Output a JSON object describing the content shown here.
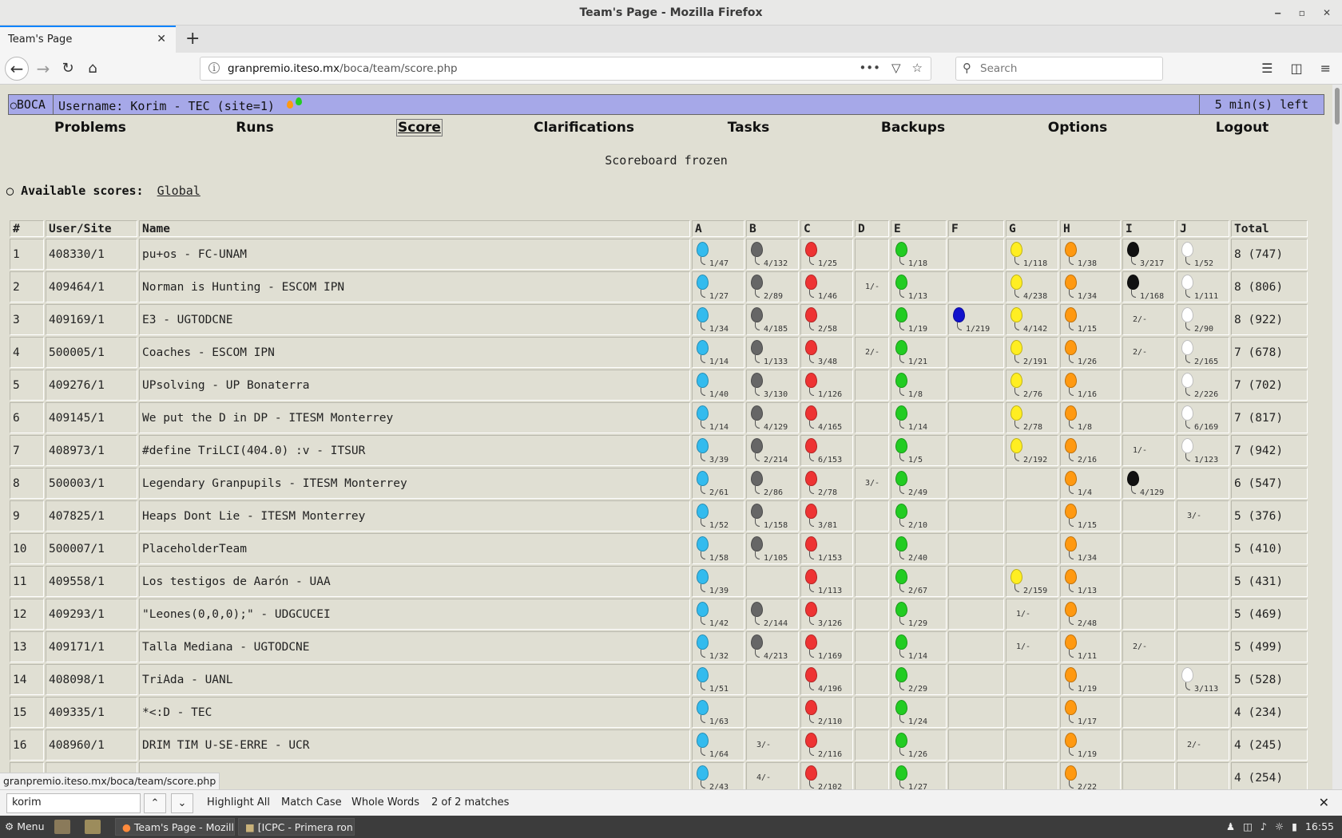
{
  "window": {
    "title": "Team's Page - Mozilla Firefox",
    "ctrl_min": "‒",
    "ctrl_max": "▫",
    "ctrl_close": "✕"
  },
  "tab": {
    "label": "Team's Page",
    "close": "✕",
    "new": "+"
  },
  "nav": {
    "url_host": "granpremio.iteso.mx",
    "url_path": "/boca/team/score.php",
    "search_placeholder": "Search"
  },
  "boca": {
    "logo": "BOCA",
    "username": "Username: Korim - TEC (site=1)",
    "time_left": "5 min(s) left",
    "menu": [
      "Problems",
      "Runs",
      "Score",
      "Clarifications",
      "Tasks",
      "Backups",
      "Options",
      "Logout"
    ],
    "frozen": "Scoreboard frozen",
    "available_label": "Available scores:",
    "available_link": "Global"
  },
  "table": {
    "headers": [
      "#",
      "User/Site",
      "Name",
      "A",
      "B",
      "C",
      "D",
      "E",
      "F",
      "G",
      "H",
      "I",
      "J",
      "Total"
    ],
    "problem_colors": {
      "A": "#33bbee",
      "B": "#666666",
      "C": "#ee3333",
      "D": "#aaaaaa",
      "E": "#22cc22",
      "F": "#1111cc",
      "G": "#ffee22",
      "H": "#ff9911",
      "I": "#111111",
      "J": "#ffffff"
    },
    "rows": [
      {
        "rank": "1",
        "user": "408330/1",
        "name": "pu+os - FC-UNAM",
        "cells": [
          [
            "s",
            "1/47"
          ],
          [
            "s",
            "4/132"
          ],
          [
            "s",
            "1/25"
          ],
          [
            "",
            ""
          ],
          [
            "s",
            "1/18"
          ],
          [
            "",
            ""
          ],
          [
            "s",
            "1/118"
          ],
          [
            "s",
            "1/38"
          ],
          [
            "s",
            "3/217"
          ],
          [
            "s",
            "1/52"
          ]
        ],
        "total": "8 (747)"
      },
      {
        "rank": "2",
        "user": "409464/1",
        "name": "Norman is Hunting - ESCOM IPN",
        "cells": [
          [
            "s",
            "1/27"
          ],
          [
            "s",
            "2/89"
          ],
          [
            "s",
            "1/46"
          ],
          [
            "t",
            "1/-"
          ],
          [
            "s",
            "1/13"
          ],
          [
            "",
            ""
          ],
          [
            "s",
            "4/238"
          ],
          [
            "s",
            "1/34"
          ],
          [
            "s",
            "1/168"
          ],
          [
            "s",
            "1/111"
          ]
        ],
        "total": "8 (806)"
      },
      {
        "rank": "3",
        "user": "409169/1",
        "name": "E3 - UGTODCNE",
        "cells": [
          [
            "s",
            "1/34"
          ],
          [
            "s",
            "4/185"
          ],
          [
            "s",
            "2/58"
          ],
          [
            "",
            ""
          ],
          [
            "s",
            "1/19"
          ],
          [
            "s",
            "1/219"
          ],
          [
            "s",
            "4/142"
          ],
          [
            "s",
            "1/15"
          ],
          [
            "t",
            "2/-"
          ],
          [
            "s",
            "2/90"
          ]
        ],
        "total": "8 (922)"
      },
      {
        "rank": "4",
        "user": "500005/1",
        "name": "Coaches - ESCOM IPN",
        "cells": [
          [
            "s",
            "1/14"
          ],
          [
            "s",
            "1/133"
          ],
          [
            "s",
            "3/48"
          ],
          [
            "t",
            "2/-"
          ],
          [
            "s",
            "1/21"
          ],
          [
            "",
            ""
          ],
          [
            "s",
            "2/191"
          ],
          [
            "s",
            "1/26"
          ],
          [
            "t",
            "2/-"
          ],
          [
            "s",
            "2/165"
          ]
        ],
        "total": "7 (678)"
      },
      {
        "rank": "5",
        "user": "409276/1",
        "name": "UPsolving - UP Bonaterra",
        "cells": [
          [
            "s",
            "1/40"
          ],
          [
            "s",
            "3/130"
          ],
          [
            "s",
            "1/126"
          ],
          [
            "",
            ""
          ],
          [
            "s",
            "1/8"
          ],
          [
            "",
            ""
          ],
          [
            "s",
            "2/76"
          ],
          [
            "s",
            "1/16"
          ],
          [
            "",
            ""
          ],
          [
            "s",
            "2/226"
          ]
        ],
        "total": "7 (702)"
      },
      {
        "rank": "6",
        "user": "409145/1",
        "name": "We put the D in DP - ITESM Monterrey",
        "cells": [
          [
            "s",
            "1/14"
          ],
          [
            "s",
            "4/129"
          ],
          [
            "s",
            "4/165"
          ],
          [
            "",
            ""
          ],
          [
            "s",
            "1/14"
          ],
          [
            "",
            ""
          ],
          [
            "s",
            "2/78"
          ],
          [
            "s",
            "1/8"
          ],
          [
            "",
            ""
          ],
          [
            "s",
            "6/169"
          ]
        ],
        "total": "7 (817)"
      },
      {
        "rank": "7",
        "user": "408973/1",
        "name": "#define TriLCI(404.0) :v - ITSUR",
        "cells": [
          [
            "s",
            "3/39"
          ],
          [
            "s",
            "2/214"
          ],
          [
            "s",
            "6/153"
          ],
          [
            "",
            ""
          ],
          [
            "s",
            "1/5"
          ],
          [
            "",
            ""
          ],
          [
            "s",
            "2/192"
          ],
          [
            "s",
            "2/16"
          ],
          [
            "t",
            "1/-"
          ],
          [
            "s",
            "1/123"
          ]
        ],
        "total": "7 (942)"
      },
      {
        "rank": "8",
        "user": "500003/1",
        "name": "Legendary Granpupils - ITESM Monterrey",
        "cells": [
          [
            "s",
            "2/61"
          ],
          [
            "s",
            "2/86"
          ],
          [
            "s",
            "2/78"
          ],
          [
            "t",
            "3/-"
          ],
          [
            "s",
            "2/49"
          ],
          [
            "",
            ""
          ],
          [
            "",
            ""
          ],
          [
            "s",
            "1/4"
          ],
          [
            "s",
            "4/129"
          ],
          [
            "",
            ""
          ]
        ],
        "total": "6 (547)"
      },
      {
        "rank": "9",
        "user": "407825/1",
        "name": "Heaps Dont Lie - ITESM Monterrey",
        "cells": [
          [
            "s",
            "1/52"
          ],
          [
            "s",
            "1/158"
          ],
          [
            "s",
            "3/81"
          ],
          [
            "",
            ""
          ],
          [
            "s",
            "2/10"
          ],
          [
            "",
            ""
          ],
          [
            "",
            ""
          ],
          [
            "s",
            "1/15"
          ],
          [
            "",
            ""
          ],
          [
            "t",
            "3/-"
          ]
        ],
        "total": "5 (376)"
      },
      {
        "rank": "10",
        "user": "500007/1",
        "name": "PlaceholderTeam",
        "cells": [
          [
            "s",
            "1/58"
          ],
          [
            "s",
            "1/105"
          ],
          [
            "s",
            "1/153"
          ],
          [
            "",
            ""
          ],
          [
            "s",
            "2/40"
          ],
          [
            "",
            ""
          ],
          [
            "",
            ""
          ],
          [
            "s",
            "1/34"
          ],
          [
            "",
            ""
          ],
          [
            "",
            ""
          ]
        ],
        "total": "5 (410)"
      },
      {
        "rank": "11",
        "user": "409558/1",
        "name": "Los testigos de Aarón - UAA",
        "cells": [
          [
            "s",
            "1/39"
          ],
          [
            "",
            ""
          ],
          [
            "s",
            "1/113"
          ],
          [
            "",
            ""
          ],
          [
            "s",
            "2/67"
          ],
          [
            "",
            ""
          ],
          [
            "s",
            "2/159"
          ],
          [
            "s",
            "1/13"
          ],
          [
            "",
            ""
          ],
          [
            "",
            ""
          ]
        ],
        "total": "5 (431)"
      },
      {
        "rank": "12",
        "user": "409293/1",
        "name": "\"Leones(0,0,0);\" - UDGCUCEI",
        "cells": [
          [
            "s",
            "1/42"
          ],
          [
            "s",
            "2/144"
          ],
          [
            "s",
            "3/126"
          ],
          [
            "",
            ""
          ],
          [
            "s",
            "1/29"
          ],
          [
            "",
            ""
          ],
          [
            "t",
            "1/-"
          ],
          [
            "s",
            "2/48"
          ],
          [
            "",
            ""
          ],
          [
            "",
            ""
          ]
        ],
        "total": "5 (469)"
      },
      {
        "rank": "13",
        "user": "409171/1",
        "name": "Talla Mediana - UGTODCNE",
        "cells": [
          [
            "s",
            "1/32"
          ],
          [
            "s",
            "4/213"
          ],
          [
            "s",
            "1/169"
          ],
          [
            "",
            ""
          ],
          [
            "s",
            "1/14"
          ],
          [
            "",
            ""
          ],
          [
            "t",
            "1/-"
          ],
          [
            "s",
            "1/11"
          ],
          [
            "t",
            "2/-"
          ],
          [
            "",
            ""
          ]
        ],
        "total": "5 (499)"
      },
      {
        "rank": "14",
        "user": "408098/1",
        "name": "TriAda - UANL",
        "cells": [
          [
            "s",
            "1/51"
          ],
          [
            "",
            ""
          ],
          [
            "s",
            "4/196"
          ],
          [
            "",
            ""
          ],
          [
            "s",
            "2/29"
          ],
          [
            "",
            ""
          ],
          [
            "",
            ""
          ],
          [
            "s",
            "1/19"
          ],
          [
            "",
            ""
          ],
          [
            "s",
            "3/113"
          ]
        ],
        "total": "5 (528)"
      },
      {
        "rank": "15",
        "user": "409335/1",
        "name": "*<:D - TEC",
        "cells": [
          [
            "s",
            "1/63"
          ],
          [
            "",
            ""
          ],
          [
            "s",
            "2/110"
          ],
          [
            "",
            ""
          ],
          [
            "s",
            "1/24"
          ],
          [
            "",
            ""
          ],
          [
            "",
            ""
          ],
          [
            "s",
            "1/17"
          ],
          [
            "",
            ""
          ],
          [
            "",
            ""
          ]
        ],
        "total": "4 (234)"
      },
      {
        "rank": "16",
        "user": "408960/1",
        "name": "DRIM TIM U-SE-ERRE - UCR",
        "cells": [
          [
            "s",
            "1/64"
          ],
          [
            "t",
            "3/-"
          ],
          [
            "s",
            "2/116"
          ],
          [
            "",
            ""
          ],
          [
            "s",
            "1/26"
          ],
          [
            "",
            ""
          ],
          [
            "",
            ""
          ],
          [
            "s",
            "1/19"
          ],
          [
            "",
            ""
          ],
          [
            "t",
            "2/-"
          ]
        ],
        "total": "4 (245)"
      },
      {
        "rank": "",
        "user": "",
        "name": "",
        "cells": [
          [
            "s",
            "2/43"
          ],
          [
            "t",
            "4/-"
          ],
          [
            "s",
            "2/102"
          ],
          [
            "",
            ""
          ],
          [
            "s",
            "1/27"
          ],
          [
            "",
            ""
          ],
          [
            "",
            ""
          ],
          [
            "s",
            "2/22"
          ],
          [
            "",
            ""
          ],
          [
            "",
            ""
          ]
        ],
        "total": "4 (254)"
      }
    ]
  },
  "status_url": "granpremio.iteso.mx/boca/team/score.php",
  "find": {
    "query": "korim",
    "highlight_all": "Highlight All",
    "match_case": "Match Case",
    "whole_words": "Whole Words",
    "matches": "2 of 2 matches"
  },
  "taskbar": {
    "menu": "Menu",
    "items": [
      "Team's Page - Mozill...",
      "[ICPC - Primera ron..."
    ],
    "clock": "16:55"
  }
}
